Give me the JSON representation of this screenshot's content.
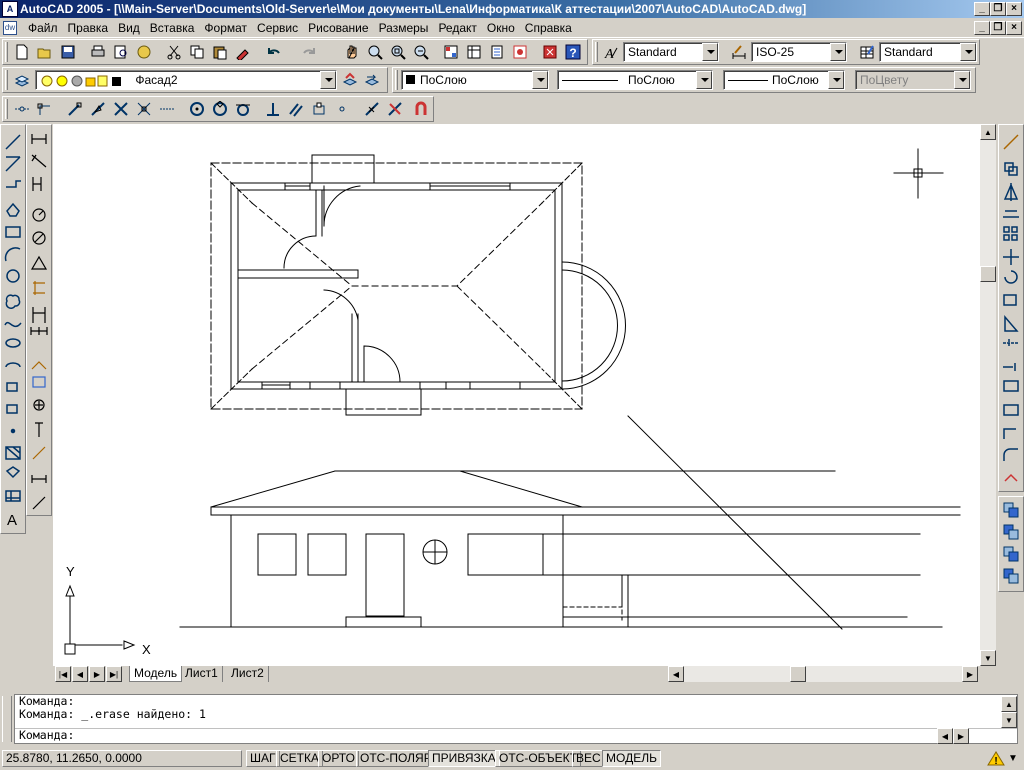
{
  "window": {
    "title": "AutoCAD 2005 - [\\\\Main-Server\\Documents\\Old-Server\\e\\Мои документы\\Lena\\Информатика\\К аттестации\\2007\\AutoCAD\\AutoCAD.dwg]",
    "app_icon_text": "A"
  },
  "menu": [
    "Файл",
    "Правка",
    "Вид",
    "Вставка",
    "Формат",
    "Сервис",
    "Рисование",
    "Размеры",
    "Редакт",
    "Окно",
    "Справка"
  ],
  "styles_toolbar": {
    "text_style": "Standard",
    "dim_style": "ISO-25",
    "table_style": "Standard"
  },
  "layers_toolbar": {
    "layer": "Фасад2",
    "color": "ПоСлою",
    "linetype": "ПоСлою",
    "lineweight": "ПоСлою",
    "plotstyle": "ПоЦвету"
  },
  "ucs": {
    "x_label": "X",
    "y_label": "Y"
  },
  "tabs": [
    "Модель",
    "Лист1",
    "Лист2"
  ],
  "active_tab": 0,
  "command_lines": [
    "Команда:",
    "Команда: _.erase найдено: 1"
  ],
  "command_prompt": "Команда:",
  "coords": "25.8780, 11.2650, 0.0000",
  "status_toggles": [
    {
      "label": "ШАГ",
      "on": false
    },
    {
      "label": "СЕТКА",
      "on": false
    },
    {
      "label": "ОРТО",
      "on": false
    },
    {
      "label": "ОТС-ПОЛЯР",
      "on": false
    },
    {
      "label": "ПРИВЯЗКА",
      "on": true
    },
    {
      "label": "ОТС-ОБЪЕКТ",
      "on": false
    },
    {
      "label": "ВЕС",
      "on": false
    },
    {
      "label": "МОДЕЛЬ",
      "on": true
    }
  ]
}
